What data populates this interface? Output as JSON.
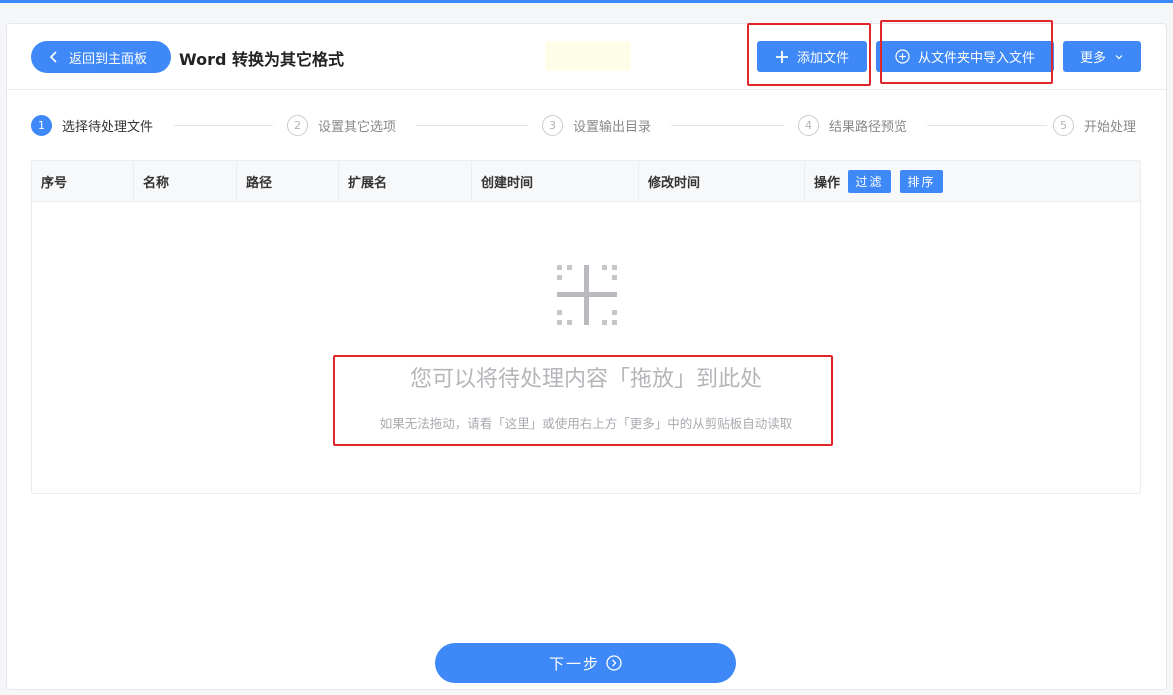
{
  "header": {
    "back_label": "返回到主面板",
    "title": "Word 转换为其它格式",
    "add_file_label": "添加文件",
    "import_folder_label": "从文件夹中导入文件",
    "more_label": "更多"
  },
  "steps": [
    {
      "num": "1",
      "label": "选择待处理文件"
    },
    {
      "num": "2",
      "label": "设置其它选项"
    },
    {
      "num": "3",
      "label": "设置输出目录"
    },
    {
      "num": "4",
      "label": "结果路径预览"
    },
    {
      "num": "5",
      "label": "开始处理"
    }
  ],
  "table": {
    "columns": [
      "序号",
      "名称",
      "路径",
      "扩展名",
      "创建时间",
      "修改时间",
      "操作"
    ],
    "filter_label": "过滤",
    "sort_label": "排序"
  },
  "dropzone": {
    "main": "您可以将待处理内容「拖放」到此处",
    "sub": "如果无法拖动，请看「这里」或使用右上方「更多」中的从剪贴板自动读取"
  },
  "footer": {
    "next_label": "下一步"
  },
  "colors": {
    "accent": "#3e88f8",
    "highlight": "#e0262b"
  }
}
